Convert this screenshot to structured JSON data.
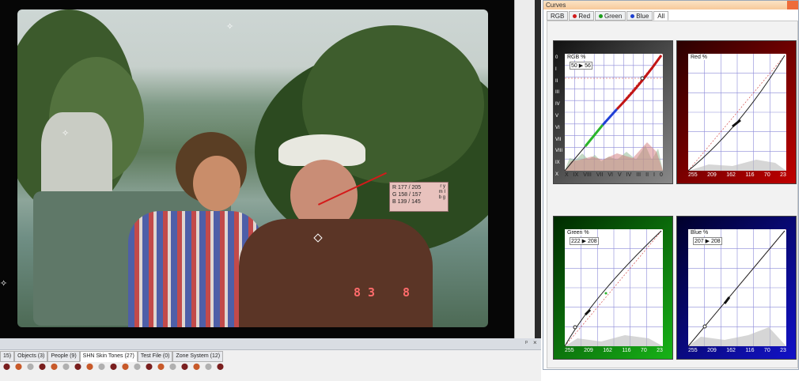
{
  "curves_panel": {
    "title": "Curves",
    "tabs": [
      {
        "label": "RGB",
        "color": ""
      },
      {
        "label": "Red",
        "color": "#d01c1c"
      },
      {
        "label": "Green",
        "color": "#1c9d1c"
      },
      {
        "label": "Blue",
        "color": "#1c3fd0"
      },
      {
        "label": "All",
        "color": ""
      }
    ],
    "active_tab": "All",
    "charts": {
      "rgb": {
        "label": "RGB %",
        "input": "50",
        "output": "56",
        "zone_ticks_y": [
          "0",
          "I",
          "II",
          "III",
          "IV",
          "V",
          "VI",
          "VII",
          "VIII",
          "IX",
          "X"
        ],
        "zone_ticks_x": [
          "X",
          "IX",
          "VIII",
          "VII",
          "VI",
          "V",
          "IV",
          "III",
          "II",
          "I",
          "0"
        ]
      },
      "red": {
        "label": "Red %",
        "input": "",
        "output": "",
        "ticks": [
          "255",
          "209",
          "162",
          "116",
          "70",
          "23"
        ]
      },
      "green": {
        "label": "Green %",
        "input": "222",
        "output": "208",
        "ticks": [
          "255",
          "209",
          "162",
          "116",
          "70",
          "23"
        ]
      },
      "blue": {
        "label": "Blue %",
        "input": "207",
        "output": "208",
        "ticks": [
          "255",
          "209",
          "162",
          "116",
          "70",
          "23"
        ]
      }
    }
  },
  "sampler": {
    "r": "R 177 / 205",
    "g": "G 158 / 157",
    "b": "B 139 / 145",
    "codes": [
      "m",
      "r",
      "y",
      "b",
      "c",
      "g",
      "I",
      "l"
    ]
  },
  "photo": {
    "overlay_left": "8 3",
    "overlay_right": "8"
  },
  "bottom_tabs": [
    {
      "label": "15)"
    },
    {
      "label": "Objects (3)"
    },
    {
      "label": "People (9)"
    },
    {
      "label": "SHN Skin Tones (27)"
    },
    {
      "label": "Test File (0)"
    },
    {
      "label": "Zone System (12)"
    }
  ],
  "active_bottom_tab": "SHN Skin Tones (27)",
  "panel_controls": {
    "pin": "ᵖ",
    "close": "×"
  },
  "thumb_count": 19
}
